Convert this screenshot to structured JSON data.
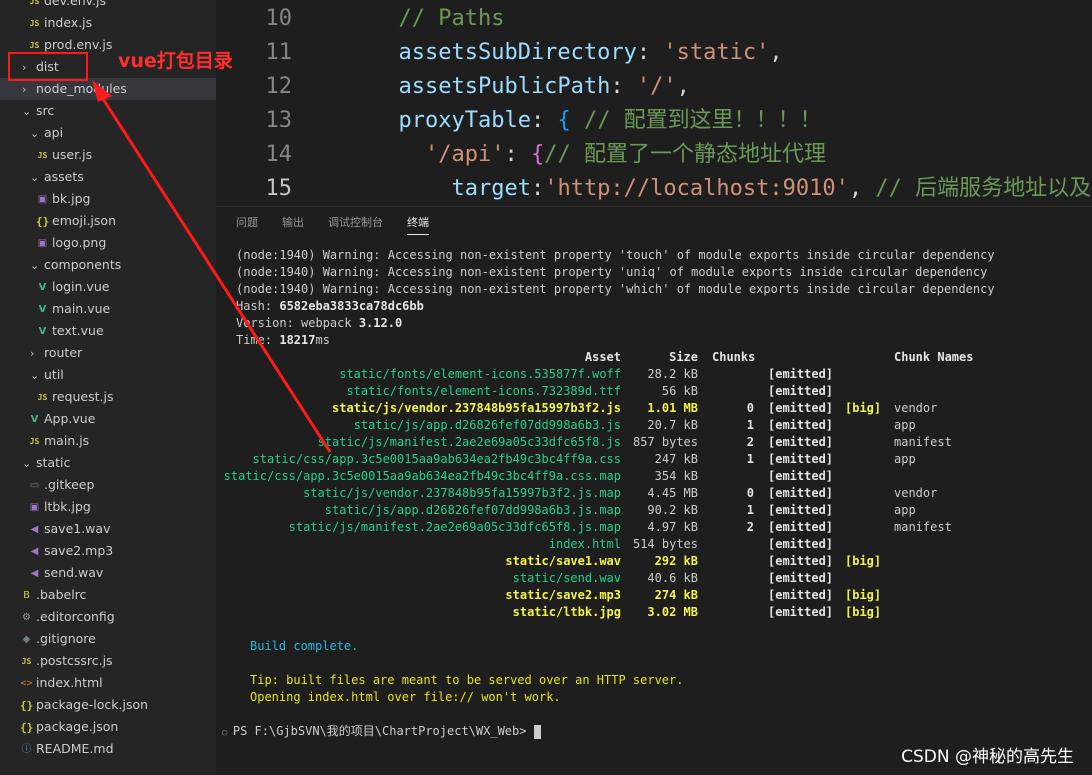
{
  "explorer": {
    "items": [
      {
        "label": "dev.env.js",
        "icon": "js",
        "indent": 2
      },
      {
        "label": "index.js",
        "icon": "js",
        "indent": 2
      },
      {
        "label": "prod.env.js",
        "icon": "js",
        "indent": 2
      },
      {
        "label": "dist",
        "icon": "chevron-right",
        "indent": 1
      },
      {
        "label": "node_modules",
        "icon": "chevron-right",
        "indent": 1
      },
      {
        "label": "src",
        "icon": "chevron-down",
        "indent": 1
      },
      {
        "label": "api",
        "icon": "chevron-down",
        "indent": 2
      },
      {
        "label": "user.js",
        "icon": "js",
        "indent": 3
      },
      {
        "label": "assets",
        "icon": "chevron-down",
        "indent": 2
      },
      {
        "label": "bk.jpg",
        "icon": "image",
        "indent": 3
      },
      {
        "label": "emoji.json",
        "icon": "json",
        "indent": 3
      },
      {
        "label": "logo.png",
        "icon": "image",
        "indent": 3
      },
      {
        "label": "components",
        "icon": "chevron-down",
        "indent": 2
      },
      {
        "label": "login.vue",
        "icon": "vue",
        "indent": 3
      },
      {
        "label": "main.vue",
        "icon": "vue",
        "indent": 3
      },
      {
        "label": "text.vue",
        "icon": "vue",
        "indent": 3
      },
      {
        "label": "router",
        "icon": "chevron-right",
        "indent": 2
      },
      {
        "label": "util",
        "icon": "chevron-down",
        "indent": 2
      },
      {
        "label": "request.js",
        "icon": "js",
        "indent": 3
      },
      {
        "label": "App.vue",
        "icon": "vue",
        "indent": 2
      },
      {
        "label": "main.js",
        "icon": "js",
        "indent": 2
      },
      {
        "label": "static",
        "icon": "chevron-down",
        "indent": 1
      },
      {
        "label": ".gitkeep",
        "icon": "file",
        "indent": 2
      },
      {
        "label": "ltbk.jpg",
        "icon": "image",
        "indent": 2
      },
      {
        "label": "save1.wav",
        "icon": "audio",
        "indent": 2
      },
      {
        "label": "save2.mp3",
        "icon": "audio",
        "indent": 2
      },
      {
        "label": "send.wav",
        "icon": "audio",
        "indent": 2
      },
      {
        "label": ".babelrc",
        "icon": "babel",
        "indent": 1
      },
      {
        "label": ".editorconfig",
        "icon": "gear",
        "indent": 1
      },
      {
        "label": ".gitignore",
        "icon": "git",
        "indent": 1
      },
      {
        "label": ".postcssrc.js",
        "icon": "js",
        "indent": 1
      },
      {
        "label": "index.html",
        "icon": "html",
        "indent": 1
      },
      {
        "label": "package-lock.json",
        "icon": "json",
        "indent": 1
      },
      {
        "label": "package.json",
        "icon": "json",
        "indent": 1
      },
      {
        "label": "README.md",
        "icon": "info",
        "indent": 1
      }
    ]
  },
  "annotation": {
    "label": "vue打包目录",
    "color": "#ff2d2d"
  },
  "editor": {
    "lines": [
      {
        "num": "10",
        "parts": [
          {
            "t": "  ",
            "c": "c-punc"
          },
          {
            "t": "// Paths",
            "c": "c-comment"
          }
        ]
      },
      {
        "num": "11",
        "parts": [
          {
            "t": "  assetsSubDirectory",
            "c": "c-key"
          },
          {
            "t": ": ",
            "c": "c-punc"
          },
          {
            "t": "'static'",
            "c": "c-str"
          },
          {
            "t": ",",
            "c": "c-punc"
          }
        ]
      },
      {
        "num": "12",
        "parts": [
          {
            "t": "  assetsPublicPath",
            "c": "c-key"
          },
          {
            "t": ": ",
            "c": "c-punc"
          },
          {
            "t": "'/'",
            "c": "c-str"
          },
          {
            "t": ",",
            "c": "c-punc"
          }
        ]
      },
      {
        "num": "13",
        "parts": [
          {
            "t": "  proxyTable",
            "c": "c-key"
          },
          {
            "t": ": ",
            "c": "c-punc"
          },
          {
            "t": "{",
            "c": "c-brace"
          },
          {
            "t": " // 配置到这里！！！！",
            "c": "c-comment"
          }
        ]
      },
      {
        "num": "14",
        "parts": [
          {
            "t": "    ",
            "c": "c-punc"
          },
          {
            "t": "'/api'",
            "c": "c-str"
          },
          {
            "t": ": ",
            "c": "c-punc"
          },
          {
            "t": "{",
            "c": "c-brace2"
          },
          {
            "t": "// 配置了一个静态地址代理",
            "c": "c-comment"
          }
        ]
      },
      {
        "num": "15",
        "parts": [
          {
            "t": "      target",
            "c": "c-key"
          },
          {
            "t": ":",
            "c": "c-punc"
          },
          {
            "t": "'http://localhost:9010'",
            "c": "c-str"
          },
          {
            "t": ", ",
            "c": "c-punc"
          },
          {
            "t": "// 后端服务地址以及",
            "c": "c-comment"
          }
        ]
      }
    ]
  },
  "panel": {
    "tabs": [
      "问题",
      "输出",
      "调试控制台",
      "终端"
    ],
    "active_tab": "终端"
  },
  "terminal": {
    "warnings": [
      "(node:1940) Warning: Accessing non-existent property 'touch' of module exports inside circular dependency",
      "(node:1940) Warning: Accessing non-existent property 'uniq' of module exports inside circular dependency",
      "(node:1940) Warning: Accessing non-existent property 'which' of module exports inside circular dependency"
    ],
    "hash_label": "Hash: ",
    "hash": "6582eba3833ca78dc6bb",
    "version_label": "Version: webpack ",
    "version": "3.12.0",
    "time_label": "Time: ",
    "time": "18217",
    "time_unit": "ms",
    "headers": {
      "asset": "Asset",
      "size": "Size",
      "chunks": "Chunks",
      "names": "Chunk Names"
    },
    "assets": [
      {
        "asset": "static/fonts/element-icons.535877f.woff",
        "size": "28.2 kB",
        "chunks": "",
        "emitted": "[emitted]",
        "big": "",
        "name": "",
        "hl": false
      },
      {
        "asset": "static/fonts/element-icons.732389d.ttf",
        "size": "56 kB",
        "chunks": "",
        "emitted": "[emitted]",
        "big": "",
        "name": "",
        "hl": false
      },
      {
        "asset": "static/js/vendor.237848b95fa15997b3f2.js",
        "size": "1.01 MB",
        "chunks": "0",
        "emitted": "[emitted]",
        "big": "[big]",
        "name": "vendor",
        "hl": true
      },
      {
        "asset": "static/js/app.d26826fef07dd998a6b3.js",
        "size": "20.7 kB",
        "chunks": "1",
        "emitted": "[emitted]",
        "big": "",
        "name": "app",
        "hl": false
      },
      {
        "asset": "static/js/manifest.2ae2e69a05c33dfc65f8.js",
        "size": "857 bytes",
        "chunks": "2",
        "emitted": "[emitted]",
        "big": "",
        "name": "manifest",
        "hl": false
      },
      {
        "asset": "static/css/app.3c5e0015aa9ab634ea2fb49c3bc4ff9a.css",
        "size": "247 kB",
        "chunks": "1",
        "emitted": "[emitted]",
        "big": "",
        "name": "app",
        "hl": false
      },
      {
        "asset": "static/css/app.3c5e0015aa9ab634ea2fb49c3bc4ff9a.css.map",
        "size": "354 kB",
        "chunks": "",
        "emitted": "[emitted]",
        "big": "",
        "name": "",
        "hl": false
      },
      {
        "asset": "static/js/vendor.237848b95fa15997b3f2.js.map",
        "size": "4.45 MB",
        "chunks": "0",
        "emitted": "[emitted]",
        "big": "",
        "name": "vendor",
        "hl": false
      },
      {
        "asset": "static/js/app.d26826fef07dd998a6b3.js.map",
        "size": "90.2 kB",
        "chunks": "1",
        "emitted": "[emitted]",
        "big": "",
        "name": "app",
        "hl": false
      },
      {
        "asset": "static/js/manifest.2ae2e69a05c33dfc65f8.js.map",
        "size": "4.97 kB",
        "chunks": "2",
        "emitted": "[emitted]",
        "big": "",
        "name": "manifest",
        "hl": false
      },
      {
        "asset": "index.html",
        "size": "514 bytes",
        "chunks": "",
        "emitted": "[emitted]",
        "big": "",
        "name": "",
        "hl": false
      },
      {
        "asset": "static/save1.wav",
        "size": "292 kB",
        "chunks": "",
        "emitted": "[emitted]",
        "big": "[big]",
        "name": "",
        "hl": true
      },
      {
        "asset": "static/send.wav",
        "size": "40.6 kB",
        "chunks": "",
        "emitted": "[emitted]",
        "big": "",
        "name": "",
        "hl": false
      },
      {
        "asset": "static/save2.mp3",
        "size": "274 kB",
        "chunks": "",
        "emitted": "[emitted]",
        "big": "[big]",
        "name": "",
        "hl": true
      },
      {
        "asset": "static/ltbk.jpg",
        "size": "3.02 MB",
        "chunks": "",
        "emitted": "[emitted]",
        "big": "[big]",
        "name": "",
        "hl": true
      }
    ],
    "build_complete": "Build complete.",
    "tip1": "Tip: built files are meant to be served over an HTTP server.",
    "tip2": "Opening index.html over file:// won't work.",
    "prompt": "PS F:\\GjbSVN\\我的项目\\ChartProject\\WX_Web> "
  },
  "watermark": "CSDN @神秘的高先生"
}
